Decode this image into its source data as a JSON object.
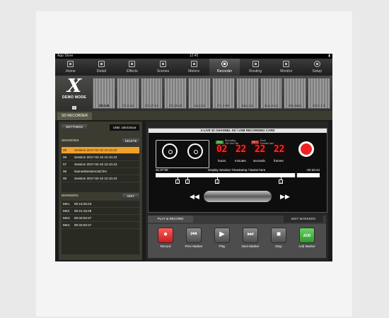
{
  "status": {
    "left": "App Store",
    "time": "12:45",
    "right": "▮"
  },
  "nav": [
    {
      "label": "Home",
      "icon": "home-icon"
    },
    {
      "label": "Detail",
      "icon": "detail-icon"
    },
    {
      "label": "Effects",
      "icon": "effects-icon"
    },
    {
      "label": "Scenes",
      "icon": "scenes-icon"
    },
    {
      "label": "Meters",
      "icon": "meters-icon"
    },
    {
      "label": "Recorder",
      "icon": "recorder-icon"
    },
    {
      "label": "Routing",
      "icon": "routing-icon"
    },
    {
      "label": "Monitor",
      "icon": "monitor-icon"
    },
    {
      "label": "Setup",
      "icon": "setup-icon"
    }
  ],
  "nav_active": "Recorder",
  "logo": {
    "mark": "X",
    "mode": "DEMO MODE",
    "badge": "T"
  },
  "banks": [
    "Ch 1-8",
    "Ch 9-16",
    "Ch 17-24",
    "Ch 25-32",
    "Aux 1-8",
    "FX 1-8R",
    "Bus 1-8",
    "Bus 9-16",
    "Mtx Main",
    "DCA 1-8"
  ],
  "bank_active": "Ch 1-8",
  "subtab": "SD RECORDER",
  "left": {
    "settings_label": "SETTINGS",
    "usb_label": "USB: 16in/16out",
    "sessions_title": "SESSIONS",
    "delete_label": "DELETE",
    "sessions": [
      {
        "n": "09",
        "name": "Session 2017-02-10 10.10.23",
        "selected": true
      },
      {
        "n": "08",
        "name": "Session 2017-02-10 10.10.23",
        "selected": false
      },
      {
        "n": "07",
        "name": "Session 2017-02-10 10.10.23",
        "selected": false
      },
      {
        "n": "06",
        "name": "NamedSession16Chrs",
        "selected": false
      },
      {
        "n": "05",
        "name": "Session 2017-02-10 10.10.23",
        "selected": false
      }
    ],
    "markers_title": "MARKERS",
    "edit_label": "EDIT",
    "markers": [
      {
        "n": "MK1",
        "time": "00:15:25:23"
      },
      {
        "n": "MK2",
        "time": "00:21:15:28"
      },
      {
        "n": "MK3",
        "time": "00:32:02:27"
      },
      {
        "n": "MK4",
        "time": "00:32:02:27"
      }
    ]
  },
  "card": {
    "title": "X-LIVE 32 CHANNEL SD / USB RECORDING CARD",
    "status1": {
      "badge": "SD1",
      "label1": "Recording",
      "label2": "12h 14m 15s"
    },
    "status2": {
      "badge": "SD 2",
      "label1": "Error!",
      "label2": "Format Card"
    },
    "time": {
      "hours": "02",
      "minutes": "22",
      "seconds": "22",
      "frames": "22"
    },
    "time_labels": {
      "hours": "hours",
      "minutes": "minutes",
      "seconds": "seconds",
      "frames": "frames"
    },
    "elapsed": "01:07:00",
    "remaining": "-02:32:44",
    "session_name": "Display Session Timestamp / Name here",
    "progress": 0.85,
    "markers": [
      "1",
      "2",
      "3",
      "4"
    ],
    "marker_positions": [
      0.12,
      0.18,
      0.36,
      0.75
    ]
  },
  "tabs": {
    "play_record": "PLAY & RECORD",
    "edit_markers": "EDIT MARKERS"
  },
  "controls": [
    {
      "label": "Record",
      "glyph": "●",
      "icon": "record-icon",
      "style": "rec"
    },
    {
      "label": "Prev Marker",
      "glyph": "⏮",
      "icon": "prev-marker-icon",
      "style": ""
    },
    {
      "label": "Play",
      "glyph": "▶",
      "icon": "play-icon",
      "style": ""
    },
    {
      "label": "Next Marker",
      "glyph": "⏭",
      "icon": "next-marker-icon",
      "style": ""
    },
    {
      "label": "Stop",
      "glyph": "■",
      "icon": "stop-icon",
      "style": ""
    },
    {
      "label": "Add Marker",
      "glyph": "ADD",
      "icon": "add-marker-icon",
      "style": "add"
    }
  ],
  "colors": {
    "selected_session": "#f0a12a",
    "timecode": "#ff2a2a",
    "record": "#e22222",
    "add": "#3fb23a"
  }
}
